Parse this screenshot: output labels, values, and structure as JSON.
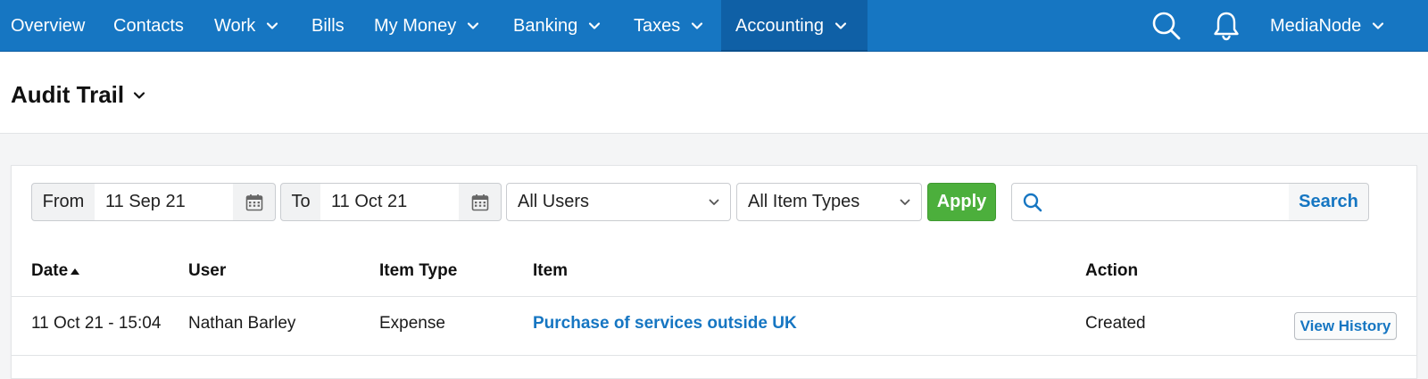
{
  "nav": {
    "items": [
      {
        "label": "Overview"
      },
      {
        "label": "Contacts"
      },
      {
        "label": "Work"
      },
      {
        "label": "Bills"
      },
      {
        "label": "My Money"
      },
      {
        "label": "Banking"
      },
      {
        "label": "Taxes"
      },
      {
        "label": "Accounting"
      }
    ],
    "account": "MediaNode",
    "icons": {
      "search": "search-icon",
      "notifications": "bell-icon"
    },
    "colors": {
      "bar": "#1676c2",
      "active": "#0f60a6"
    }
  },
  "page": {
    "title": "Audit Trail"
  },
  "filters": {
    "from_label": "From",
    "from_value": "11 Sep 21",
    "to_label": "To",
    "to_value": "11 Oct 21",
    "users_selected": "All Users",
    "item_types_selected": "All Item Types",
    "apply_label": "Apply",
    "search_value": "",
    "search_label": "Search",
    "colors": {
      "apply": "#4caf3c",
      "link": "#1676c2"
    }
  },
  "table": {
    "columns": {
      "date": "Date",
      "user": "User",
      "item_type": "Item Type",
      "item": "Item",
      "action": "Action"
    },
    "sort": {
      "column": "date",
      "direction": "ascending"
    },
    "rows": [
      {
        "date": "11 Oct 21 - 15:04",
        "user": "Nathan Barley",
        "item_type": "Expense",
        "item": "Purchase of services outside UK",
        "action": "Created",
        "history_label": "View History"
      }
    ]
  }
}
